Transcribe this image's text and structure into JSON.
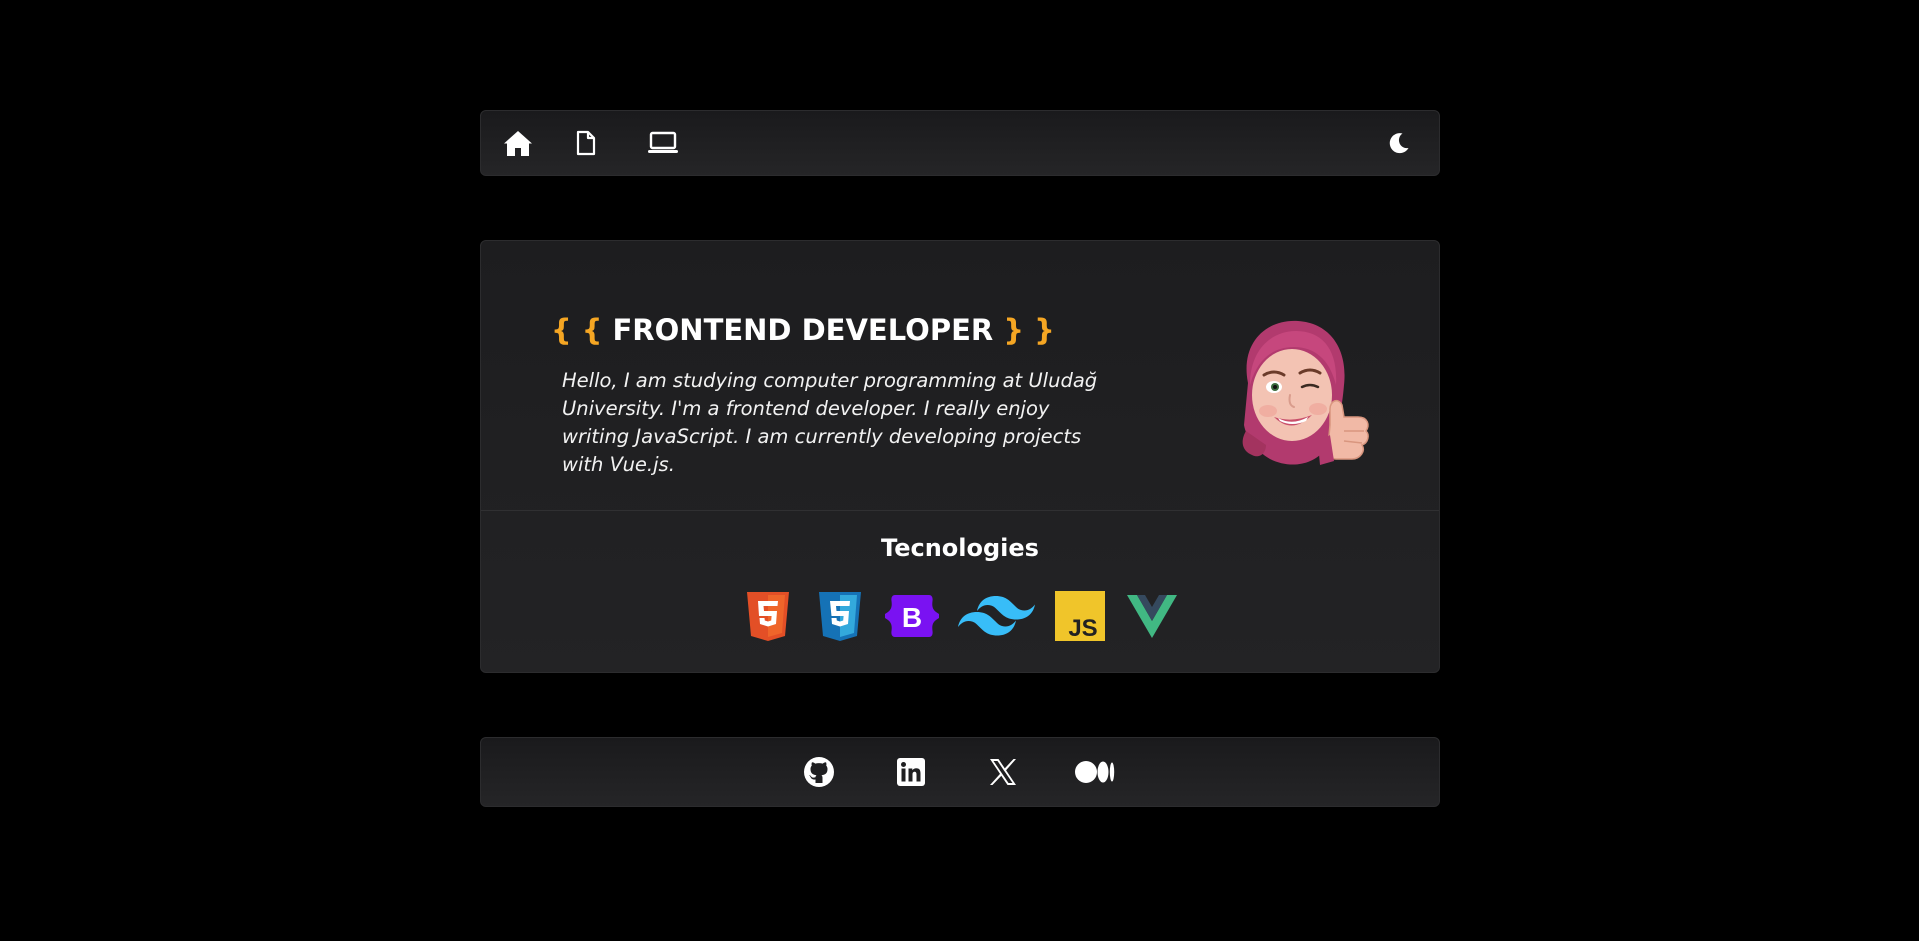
{
  "nav": {
    "items": [
      {
        "name": "home",
        "icon": "home-icon"
      },
      {
        "name": "resume",
        "icon": "document-icon"
      },
      {
        "name": "projects",
        "icon": "laptop-icon"
      }
    ],
    "theme_toggle_icon": "moon-icon"
  },
  "hero": {
    "brace_open": "{ {",
    "title": "FRONTEND DEVELOPER",
    "brace_close": "} }",
    "description": "Hello, I am studying computer programming at Uludağ University. I'm a frontend developer. I really enjoy writing JavaScript. I am currently developing projects with Vue.js.",
    "avatar_icon": "memoji-avatar"
  },
  "technologies": {
    "title": "Tecnologies",
    "items": [
      {
        "name": "HTML5",
        "icon": "html5-icon",
        "color": "#e34f26"
      },
      {
        "name": "CSS3",
        "icon": "css3-icon",
        "color": "#1572b6"
      },
      {
        "name": "Bootstrap",
        "icon": "bootstrap-icon",
        "color": "#7a12f2"
      },
      {
        "name": "Tailwind CSS",
        "icon": "tailwind-icon",
        "color": "#38bdf8"
      },
      {
        "name": "JavaScript",
        "icon": "javascript-icon",
        "color": "#f0db4f"
      },
      {
        "name": "Vue.js",
        "icon": "vue-icon",
        "color": "#41b883"
      }
    ]
  },
  "footer": {
    "links": [
      {
        "name": "GitHub",
        "icon": "github-icon"
      },
      {
        "name": "LinkedIn",
        "icon": "linkedin-icon"
      },
      {
        "name": "X",
        "icon": "x-icon"
      },
      {
        "name": "Medium",
        "icon": "medium-icon"
      }
    ]
  },
  "colors": {
    "background": "#000000",
    "panel": "#1f1f21",
    "accent_brace": "#f5a623",
    "text": "#ffffff"
  }
}
